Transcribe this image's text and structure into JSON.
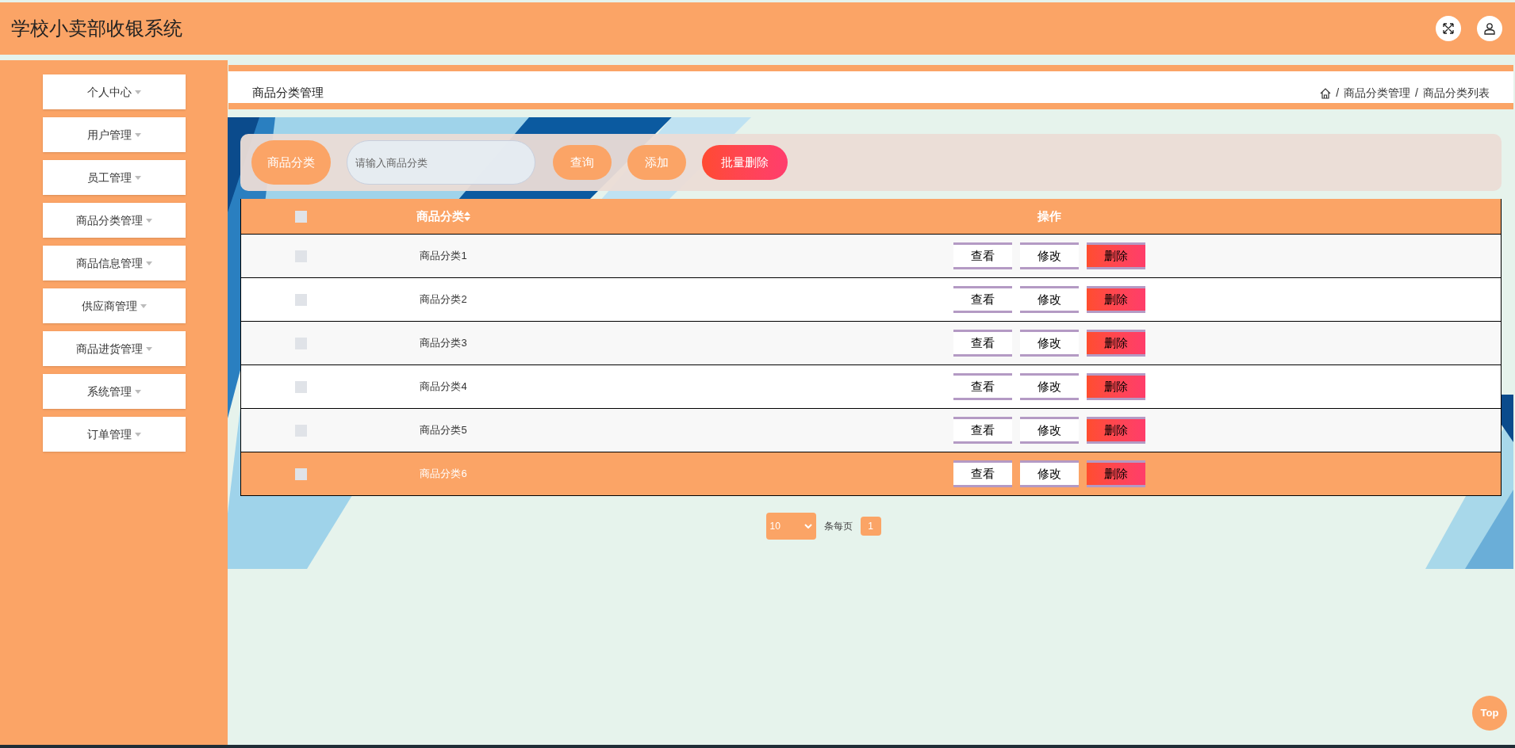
{
  "header": {
    "title": "学校小卖部收银系统"
  },
  "sidebar": {
    "items": [
      {
        "label": "个人中心"
      },
      {
        "label": "用户管理"
      },
      {
        "label": "员工管理"
      },
      {
        "label": "商品分类管理"
      },
      {
        "label": "商品信息管理"
      },
      {
        "label": "供应商管理"
      },
      {
        "label": "商品进货管理"
      },
      {
        "label": "系统管理"
      },
      {
        "label": "订单管理"
      }
    ]
  },
  "page_title": "商品分类管理",
  "breadcrumb": [
    {
      "kind": "separator",
      "text": "/"
    },
    {
      "kind": "link",
      "text": "商品分类管理"
    },
    {
      "kind": "separator",
      "text": "/"
    },
    {
      "kind": "link",
      "text": "商品分类列表"
    }
  ],
  "search": {
    "label": "商品分类",
    "placeholder": "请输入商品分类",
    "buttons": [
      {
        "label": "查询",
        "kind": "query"
      },
      {
        "label": "添加",
        "kind": "add"
      },
      {
        "label": "批量删除",
        "kind": "delete"
      }
    ]
  },
  "table": {
    "columns": [
      "商品分类",
      "操作"
    ],
    "header_checked": false,
    "rows": [
      {
        "name": "商品分类1",
        "checked": false,
        "selected": false,
        "actions": [
          "查看",
          "修改",
          "删除"
        ]
      },
      {
        "name": "商品分类2",
        "checked": false,
        "selected": false,
        "actions": [
          "查看",
          "修改",
          "删除"
        ]
      },
      {
        "name": "商品分类3",
        "checked": false,
        "selected": false,
        "actions": [
          "查看",
          "修改",
          "删除"
        ]
      },
      {
        "name": "商品分类4",
        "checked": false,
        "selected": false,
        "actions": [
          "查看",
          "修改",
          "删除"
        ]
      },
      {
        "name": "商品分类5",
        "checked": false,
        "selected": false,
        "actions": [
          "查看",
          "修改",
          "删除"
        ]
      },
      {
        "name": "商品分类6",
        "checked": false,
        "selected": true,
        "actions": [
          "查看",
          "修改",
          "删除"
        ]
      }
    ]
  },
  "pagination": {
    "page_size": "10",
    "per_page_label": "条每页",
    "pages": [
      {
        "label": "1",
        "selected": true
      }
    ]
  },
  "back_to_top": "Top"
}
